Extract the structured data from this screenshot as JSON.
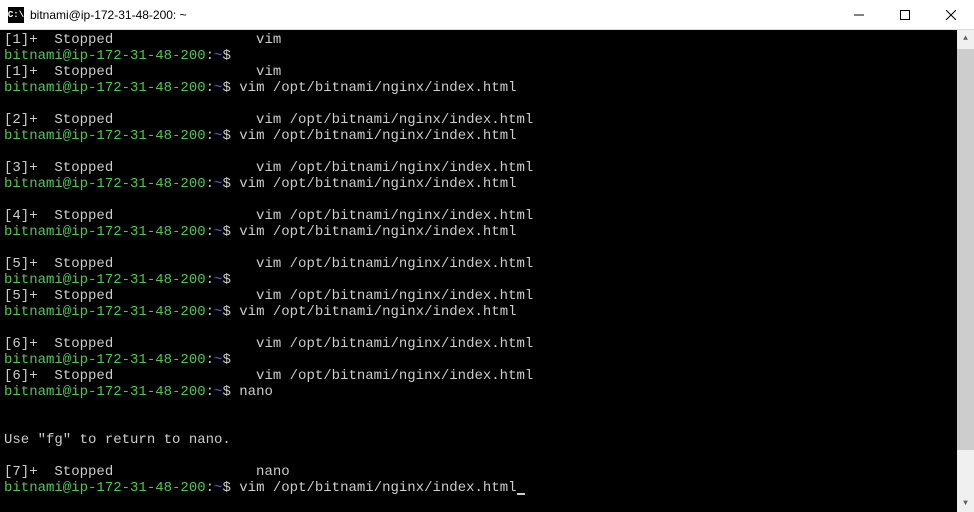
{
  "window": {
    "title": "bitnami@ip-172-31-48-200: ~",
    "icon_label": "C:\\"
  },
  "prompt": {
    "user_host": "bitnami@ip-172-31-48-200",
    "colon": ":",
    "path": "~",
    "dollar": "$"
  },
  "lines": [
    {
      "type": "stopped",
      "num": "[1]+",
      "status": "Stopped",
      "cmd": "vim"
    },
    {
      "type": "prompt",
      "cmd": ""
    },
    {
      "type": "stopped",
      "num": "[1]+",
      "status": "Stopped",
      "cmd": "vim"
    },
    {
      "type": "prompt",
      "cmd": "vim /opt/bitnami/nginx/index.html"
    },
    {
      "type": "blank"
    },
    {
      "type": "stopped",
      "num": "[2]+",
      "status": "Stopped",
      "cmd": "vim /opt/bitnami/nginx/index.html"
    },
    {
      "type": "prompt",
      "cmd": "vim /opt/bitnami/nginx/index.html"
    },
    {
      "type": "blank"
    },
    {
      "type": "stopped",
      "num": "[3]+",
      "status": "Stopped",
      "cmd": "vim /opt/bitnami/nginx/index.html"
    },
    {
      "type": "prompt",
      "cmd": "vim /opt/bitnami/nginx/index.html"
    },
    {
      "type": "blank"
    },
    {
      "type": "stopped",
      "num": "[4]+",
      "status": "Stopped",
      "cmd": "vim /opt/bitnami/nginx/index.html"
    },
    {
      "type": "prompt",
      "cmd": "vim /opt/bitnami/nginx/index.html"
    },
    {
      "type": "blank"
    },
    {
      "type": "stopped",
      "num": "[5]+",
      "status": "Stopped",
      "cmd": "vim /opt/bitnami/nginx/index.html"
    },
    {
      "type": "prompt",
      "cmd": ""
    },
    {
      "type": "stopped",
      "num": "[5]+",
      "status": "Stopped",
      "cmd": "vim /opt/bitnami/nginx/index.html"
    },
    {
      "type": "prompt",
      "cmd": "vim /opt/bitnami/nginx/index.html"
    },
    {
      "type": "blank"
    },
    {
      "type": "stopped",
      "num": "[6]+",
      "status": "Stopped",
      "cmd": "vim /opt/bitnami/nginx/index.html"
    },
    {
      "type": "prompt",
      "cmd": ""
    },
    {
      "type": "stopped",
      "num": "[6]+",
      "status": "Stopped",
      "cmd": "vim /opt/bitnami/nginx/index.html"
    },
    {
      "type": "prompt",
      "cmd": "nano"
    },
    {
      "type": "blank"
    },
    {
      "type": "blank"
    },
    {
      "type": "text",
      "text": "Use \"fg\" to return to nano."
    },
    {
      "type": "blank"
    },
    {
      "type": "stopped",
      "num": "[7]+",
      "status": "Stopped",
      "cmd": "nano"
    },
    {
      "type": "prompt",
      "cmd": "vim /opt/bitnami/nginx/index.html",
      "cursor": true
    }
  ]
}
